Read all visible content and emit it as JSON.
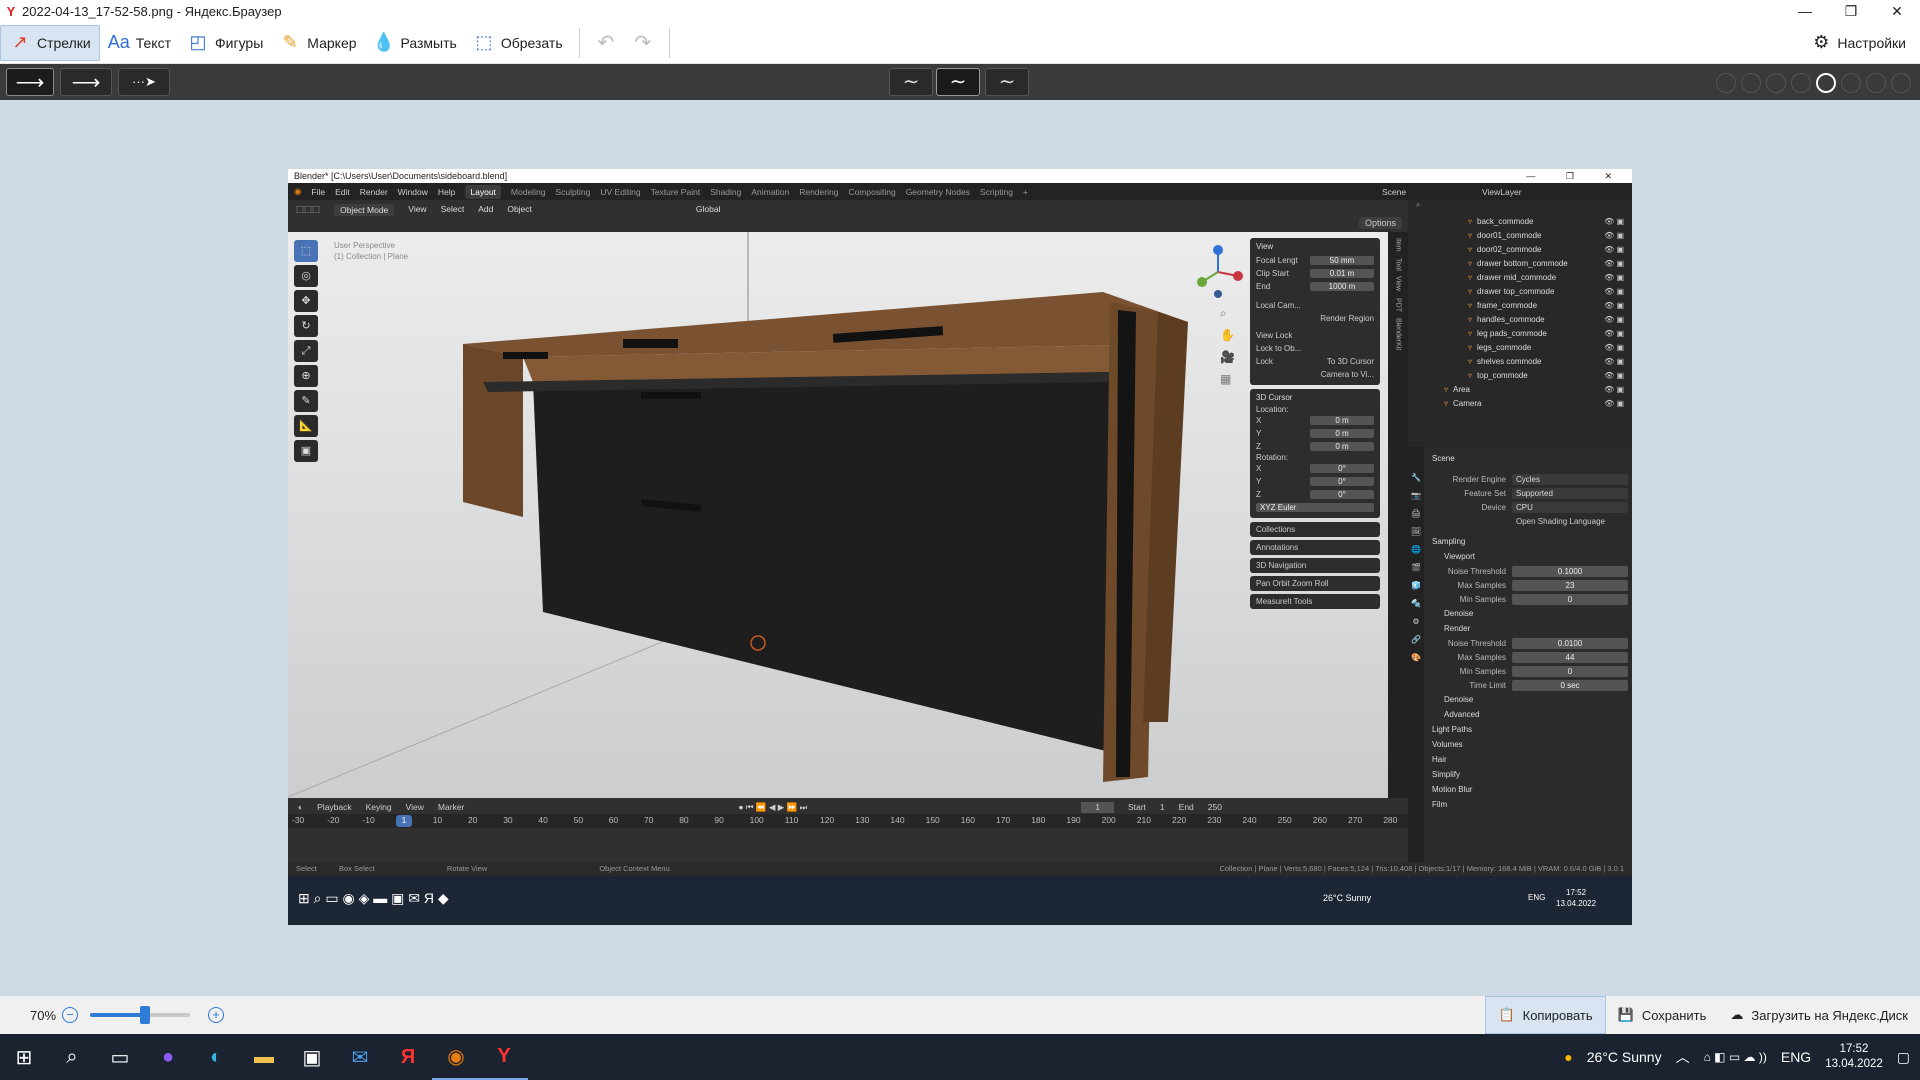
{
  "window": {
    "title": "2022-04-13_17-52-58.png - Яндекс.Браузер"
  },
  "toolbar": {
    "tools": [
      {
        "label": "Стрелки",
        "icon": "arrow-icon",
        "active": true
      },
      {
        "label": "Текст",
        "icon": "text-icon",
        "active": false
      },
      {
        "label": "Фигуры",
        "icon": "shapes-icon",
        "active": false
      },
      {
        "label": "Маркер",
        "icon": "marker-icon",
        "active": false
      },
      {
        "label": "Размыть",
        "icon": "blur-icon",
        "active": false
      },
      {
        "label": "Обрезать",
        "icon": "crop-icon",
        "active": false
      }
    ],
    "settings_label": "Настройки"
  },
  "subbar": {
    "palette": [
      "#333333",
      "#ffffff",
      "#3b7de0",
      "#f1c232",
      "#e84545",
      "#7dc242",
      "#a661c9",
      "#8a8a8a"
    ],
    "selected_color": "#e84545"
  },
  "blender": {
    "title": "Blender* [C:\\Users\\User\\Documents\\sideboard.blend]",
    "menus": [
      "File",
      "Edit",
      "Render",
      "Window",
      "Help"
    ],
    "workspaces": [
      "Layout",
      "Modeling",
      "Sculpting",
      "UV Editing",
      "Texture Paint",
      "Shading",
      "Animation",
      "Rendering",
      "Compositing",
      "Geometry Nodes",
      "Scripting"
    ],
    "active_workspace": "Layout",
    "scene_label": "Scene",
    "viewlayer_label": "ViewLayer",
    "header": {
      "mode": "Object Mode",
      "menus": [
        "View",
        "Select",
        "Add",
        "Object"
      ],
      "orientation": "Global",
      "options": "Options"
    },
    "viewport_label_1": "User Perspective",
    "viewport_label_2": "(1) Collection | Plane",
    "npanel": {
      "view_header": "View",
      "focal_length_label": "Focal Lengt",
      "focal_length": "50 mm",
      "clip_start_label": "Clip Start",
      "clip_start": "0.01 m",
      "clip_end_label": "End",
      "clip_end": "1000 m",
      "local_camera_label": "Local Cam...",
      "render_region": "Render Region",
      "view_lock": "View Lock",
      "lock_to_object": "Lock to Ob...",
      "lock_label": "Lock",
      "to_3d_cursor": "To 3D Cursor",
      "camera_to_view": "Camera to Vi...",
      "cursor_header": "3D Cursor",
      "location_label": "Location:",
      "loc_x": "0 m",
      "loc_y": "0 m",
      "loc_z": "0 m",
      "rotation_label": "Rotation:",
      "rot_x": "0°",
      "rot_y": "0°",
      "rot_z": "0°",
      "rotation_mode": "XYZ Euler",
      "collapsed": [
        "Collections",
        "Annotations",
        "3D Navigation",
        "Pan Orbit Zoom Roll",
        "MeasureIt Tools"
      ]
    },
    "timeline": {
      "menus": [
        "Playback",
        "Keying",
        "View",
        "Marker"
      ],
      "current_frame": "1",
      "start_label": "Start",
      "start": "1",
      "end_label": "End",
      "end": "250",
      "ticks": [
        "-30",
        "-20",
        "-10",
        "1",
        "10",
        "20",
        "30",
        "40",
        "50",
        "60",
        "70",
        "80",
        "90",
        "100",
        "110",
        "120",
        "130",
        "140",
        "150",
        "160",
        "170",
        "180",
        "190",
        "200",
        "210",
        "220",
        "230",
        "240",
        "250",
        "260",
        "270",
        "280"
      ]
    },
    "statusbar": {
      "select": "Select",
      "box_select": "Box Select",
      "rotate_view": "Rotate View",
      "context_menu": "Object Context Menu",
      "stats": "Collection | Plane | Verts:5,680 | Faces:5,124 | Tris:10,408 | Objects:1/17 | Memory: 168.4 MiB | VRAM: 0.6/4.0 GiB | 3.0.1"
    },
    "outliner_items": [
      "back_commode",
      "door01_commode",
      "door02_commode",
      "drawer bottom_commode",
      "drawer mid_commode",
      "drawer top_commode",
      "frame_commode",
      "handles_commode",
      "leg pads_commode",
      "legs_commode",
      "shelves commode",
      "top_commode",
      "Area",
      "Camera"
    ],
    "properties": {
      "scene": "Scene",
      "render_engine_label": "Render Engine",
      "render_engine": "Cycles",
      "feature_set_label": "Feature Set",
      "feature_set": "Supported",
      "device_label": "Device",
      "device": "CPU",
      "osl": "Open Shading Language",
      "sampling": "Sampling",
      "viewport": "Viewport",
      "noise_threshold_label": "Noise Threshold",
      "vp_noise": "0.1000",
      "max_samples_label": "Max Samples",
      "vp_max": "23",
      "min_samples_label": "Min Samples",
      "vp_min": "0",
      "denoise": "Denoise",
      "render": "Render",
      "r_noise": "0.0100",
      "r_max": "44",
      "r_min": "0",
      "time_limit_label": "Time Limit",
      "time_limit": "0 sec",
      "advanced": "Advanced",
      "sections": [
        "Light Paths",
        "Volumes",
        "Hair",
        "Simplify",
        "Motion Blur",
        "Film"
      ]
    },
    "taskbar": {
      "weather": "26°C  Sunny",
      "lang": "ENG",
      "time": "17:52",
      "date": "13.04.2022"
    }
  },
  "bottombar": {
    "zoom": "70%",
    "zoom_fraction": 0.55,
    "copy": "Копировать",
    "save": "Сохранить",
    "upload": "Загрузить на Яндекс.Диск"
  },
  "taskbar": {
    "weather": "26°C  Sunny",
    "lang": "ENG",
    "time": "17:52",
    "date": "13.04.2022"
  }
}
